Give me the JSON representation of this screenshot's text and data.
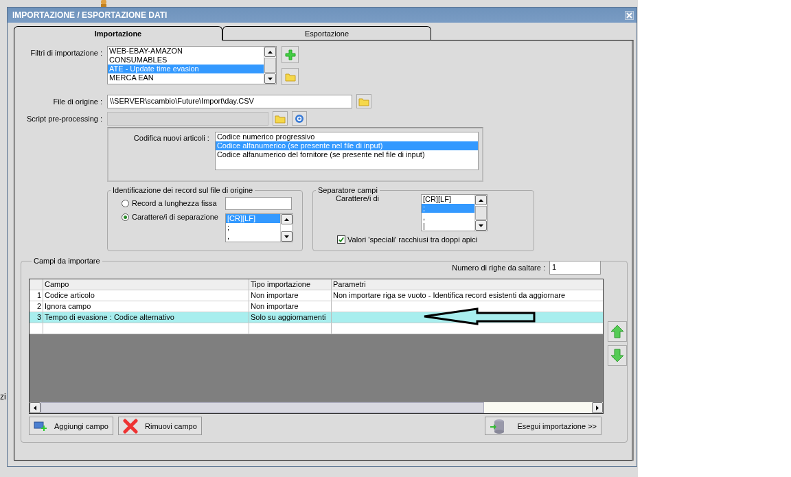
{
  "window": {
    "title": "IMPORTAZIONE / ESPORTAZIONE DATI"
  },
  "background_text": "zi",
  "tabs": [
    {
      "label": "Importazione",
      "selected": true
    },
    {
      "label": "Esportazione",
      "selected": false
    }
  ],
  "filters": {
    "label": "Filtri di importazione :",
    "items": [
      {
        "label": "WEB-EBAY-AMAZON",
        "selected": false
      },
      {
        "label": "CONSUMABLES",
        "selected": false
      },
      {
        "label": "ATE - Update time evasion",
        "selected": true
      },
      {
        "label": "MERCA EAN",
        "selected": false
      }
    ]
  },
  "source_file": {
    "label": "File di origine :",
    "value": "\\\\SERVER\\scambio\\Future\\Import\\day.CSV"
  },
  "script": {
    "label": "Script pre-processing :",
    "disabled": true
  },
  "coding": {
    "label": "Codifica nuovi articoli :",
    "items": [
      {
        "label": "Codice numerico progressivo",
        "selected": false
      },
      {
        "label": "Codice alfanumerico (se presente nel file di input)",
        "selected": true
      },
      {
        "label": "Codice alfanumerico del fornitore (se presente nel file di input)",
        "selected": false
      }
    ]
  },
  "record_id": {
    "title": "Identificazione dei record sul file di origine",
    "options": [
      {
        "label": "Record a lunghezza fissa",
        "selected": false
      },
      {
        "label": "Carattere/i di separazione",
        "selected": true
      }
    ],
    "separators": [
      {
        "label": "[CR][LF]",
        "selected": true
      },
      {
        "label": ";",
        "selected": false
      },
      {
        "label": ",",
        "selected": false
      }
    ]
  },
  "field_separator": {
    "title": "Separatore campi",
    "label": "Carattere/i di",
    "items": [
      {
        "label": "[CR][LF]",
        "selected": false
      },
      {
        "label": ";",
        "selected": true
      },
      {
        "label": ",",
        "selected": false
      },
      {
        "label": "|",
        "selected": false
      }
    ],
    "quoted": {
      "label": "Valori 'speciali' racchiusi tra doppi apici",
      "checked": true
    }
  },
  "fields": {
    "title": "Campi da importare",
    "skip_rows": {
      "label": "Numero di righe da saltare :",
      "value": "1"
    },
    "table": {
      "columns": [
        "Campo",
        "Tipo importazione",
        "Parametri"
      ],
      "rows": [
        {
          "number": "1",
          "cells": [
            "Codice articolo",
            "Non importare",
            "Non importare riga se vuoto - Identifica record esistenti da aggiornare"
          ],
          "selected": false
        },
        {
          "number": "2",
          "cells": [
            "Ignora campo",
            "Non importare",
            ""
          ],
          "selected": false
        },
        {
          "number": "3",
          "cells": [
            "Tempo di evasione : Codice alternativo",
            "Solo su aggiornamenti",
            ""
          ],
          "selected": true
        }
      ]
    },
    "buttons": [
      {
        "label": "Aggiungi campo",
        "kind": "add"
      },
      {
        "label": "Rimuovi campo",
        "kind": "remove"
      },
      {
        "label": "Esegui importazione >>",
        "kind": "run"
      }
    ]
  }
}
